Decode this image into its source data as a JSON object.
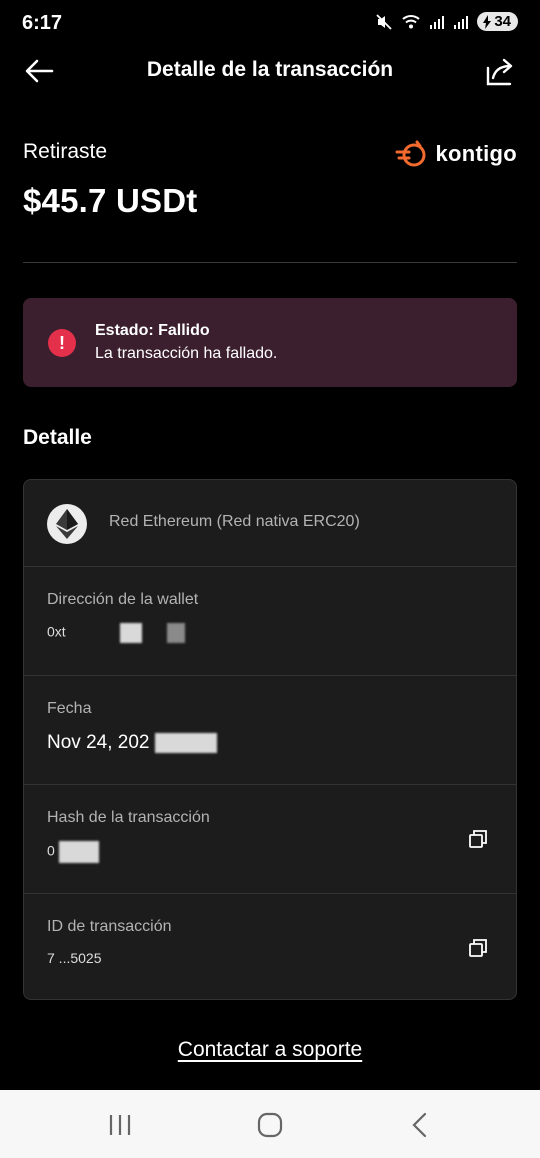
{
  "status_bar": {
    "time": "6:17",
    "battery": "34"
  },
  "header": {
    "title": "Detalle de la transacción"
  },
  "brand": {
    "name": "kontigo"
  },
  "summary": {
    "label": "Retiraste",
    "amount": "$45.7 USDt"
  },
  "status": {
    "title": "Estado: Fallido",
    "description": "La transacción ha fallado.",
    "icon": "!",
    "color": "#e5304b"
  },
  "details_section": {
    "title": "Detalle",
    "network": "Red Ethereum (Red nativa ERC20)",
    "wallet": {
      "label": "Dirección de la wallet",
      "value": "0xt"
    },
    "date": {
      "label": "Fecha",
      "value": "Nov 24, 202"
    },
    "hash": {
      "label": "Hash de la transacción",
      "value": "0"
    },
    "tx_id": {
      "label": "ID de transacción",
      "value": "7 ...5025"
    }
  },
  "support": {
    "link": "Contactar a soporte"
  },
  "colors": {
    "background": "#000000",
    "card": "#1c1c1c",
    "status_card": "#3b1f2e",
    "accent": "#f26a2e"
  },
  "icons": [
    "back-arrow-icon",
    "share-icon",
    "kontigo-logo-icon",
    "error-icon",
    "ethereum-icon",
    "copy-icon",
    "recent-apps-icon",
    "home-icon",
    "back-icon"
  ]
}
